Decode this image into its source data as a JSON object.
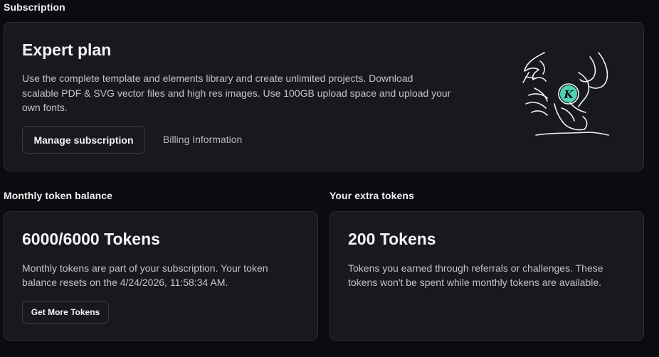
{
  "subscription": {
    "section_title": "Subscription",
    "plan": {
      "title": "Expert plan",
      "description_lines": [
        "Use the complete template and elements library and create unlimited projects. Download",
        "scalable PDF & SVG vector files and high res images. Use 100GB upload space and upload your",
        "own fonts."
      ],
      "manage_label": "Manage subscription",
      "billing_label": "Billing Information",
      "badge_letter": "K",
      "accent_color": "#4fd1b5"
    }
  },
  "monthly": {
    "section_title": "Monthly token balance",
    "amount": "6000/6000 Tokens",
    "description_lines": [
      "Monthly tokens are part of your subscription. Your token",
      "balance resets on the 4/24/2026, 11:58:34 AM."
    ],
    "button_label": "Get More Tokens"
  },
  "extra": {
    "section_title": "Your extra tokens",
    "amount": "200 Tokens",
    "description_lines": [
      "Tokens you earned through referrals or challenges. These",
      "tokens won't be spent while monthly tokens are available."
    ]
  }
}
